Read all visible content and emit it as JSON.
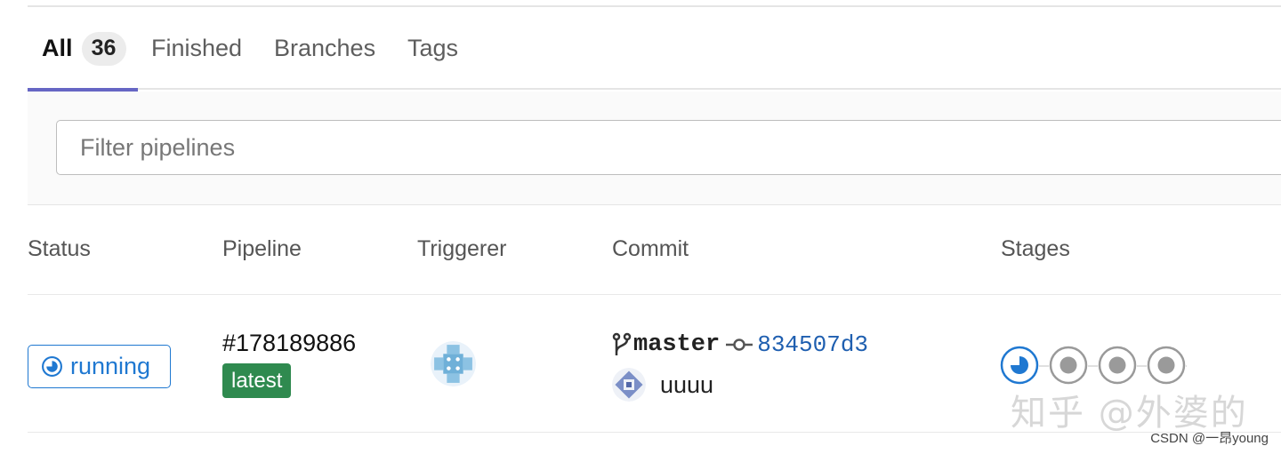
{
  "tabs": [
    {
      "label": "All",
      "count": "36",
      "active": true
    },
    {
      "label": "Finished"
    },
    {
      "label": "Branches"
    },
    {
      "label": "Tags"
    }
  ],
  "filter": {
    "placeholder": "Filter pipelines"
  },
  "columns": [
    "Status",
    "Pipeline",
    "Triggerer",
    "Commit",
    "Stages"
  ],
  "rows": [
    {
      "status": "running",
      "status_icon": "running-icon",
      "pipeline_id": "#178189886",
      "badge": "latest",
      "commit": {
        "branch": "master",
        "sha": "834507d3",
        "title": "uuuu"
      },
      "stages": [
        "running",
        "created",
        "created",
        "created"
      ]
    }
  ],
  "watermark": "知乎 @外婆的",
  "credit": "CSDN @一昂young",
  "colors": {
    "accent": "#6666c4",
    "running": "#1f78d1",
    "latest_badge": "#2f8a4f",
    "sha_link": "#1f5fb0"
  }
}
